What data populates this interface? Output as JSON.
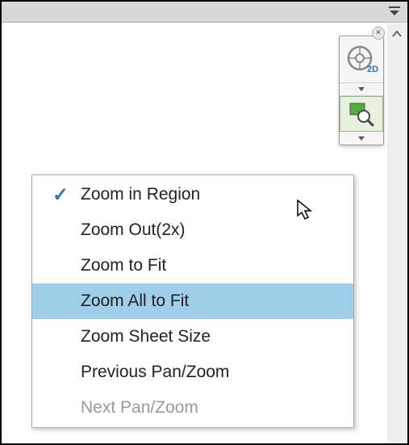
{
  "titlebar": {
    "dropdown_icon": "panel-dropdown"
  },
  "toolbar": {
    "close_label": "✕",
    "nav_wheel_label": "2D",
    "zoom_region_label": "zoom-region"
  },
  "menu": {
    "items": [
      {
        "label": "Zoom in Region",
        "checked": true,
        "highlighted": false,
        "enabled": true
      },
      {
        "label": "Zoom Out(2x)",
        "checked": false,
        "highlighted": false,
        "enabled": true
      },
      {
        "label": "Zoom to Fit",
        "checked": false,
        "highlighted": false,
        "enabled": true
      },
      {
        "label": "Zoom All to Fit",
        "checked": false,
        "highlighted": true,
        "enabled": true
      },
      {
        "label": "Zoom Sheet Size",
        "checked": false,
        "highlighted": false,
        "enabled": true
      },
      {
        "label": "Previous Pan/Zoom",
        "checked": false,
        "highlighted": false,
        "enabled": true
      },
      {
        "label": "Next Pan/Zoom",
        "checked": false,
        "highlighted": false,
        "enabled": false
      }
    ]
  }
}
